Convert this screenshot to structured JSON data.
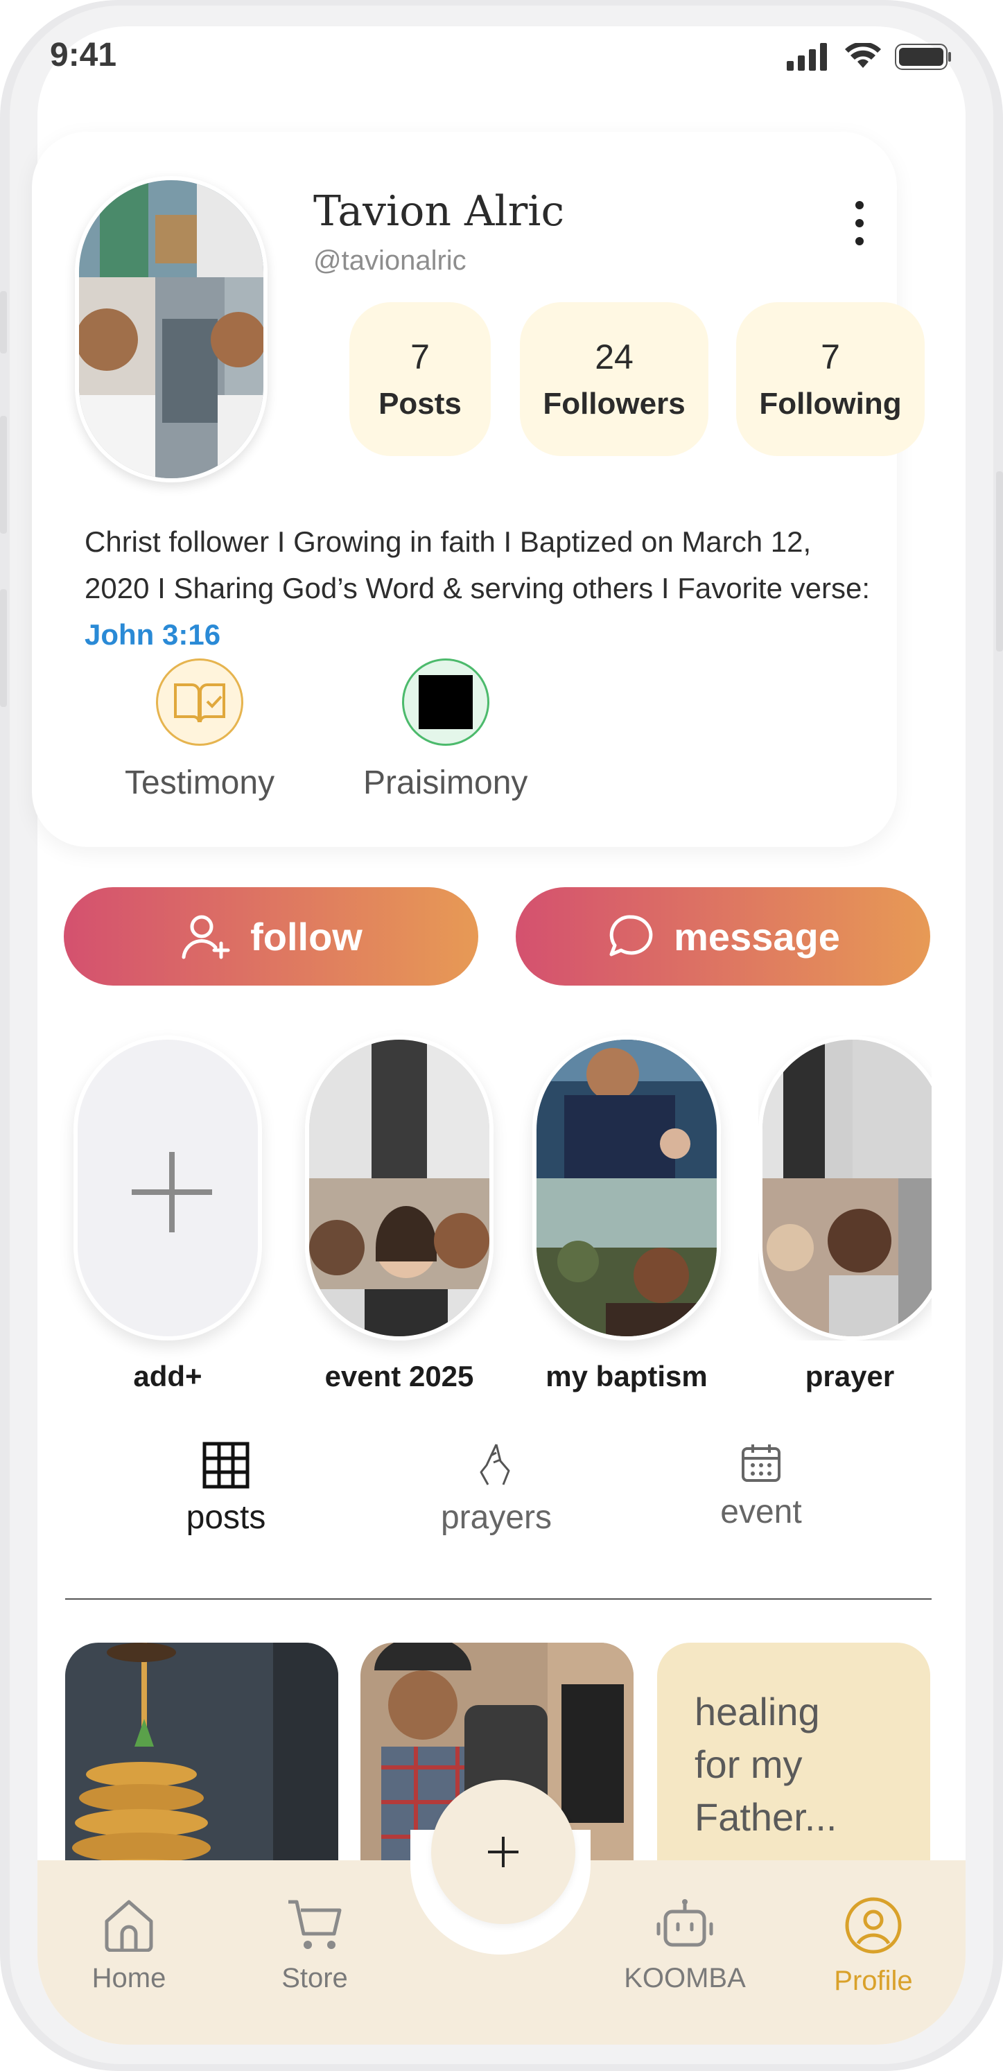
{
  "status_bar": {
    "time": "9:41"
  },
  "profile": {
    "name": "Tavion Alric",
    "handle": "@tavionalric",
    "stats": [
      {
        "value": "7",
        "label": "Posts"
      },
      {
        "value": "24",
        "label": "Followers"
      },
      {
        "value": "7",
        "label": "Following"
      }
    ],
    "bio_text": "Christ follower I Growing in faith I Baptized on March 12, 2020 I Sharing God’s Word & serving others I Favorite verse: ",
    "bio_verse": "John 3:16",
    "badges": [
      {
        "label": "Testimony",
        "icon": "book-check-icon"
      },
      {
        "label": "Praisimony",
        "icon": "black-square-icon"
      }
    ]
  },
  "actions": {
    "follow_label": "follow",
    "message_label": "message"
  },
  "stories": [
    {
      "label": "add+"
    },
    {
      "label": "event 2025"
    },
    {
      "label": "my baptism"
    },
    {
      "label": "prayer"
    }
  ],
  "tabs": [
    {
      "label": "posts",
      "icon": "grid-icon",
      "active": true
    },
    {
      "label": "prayers",
      "icon": "praying-hands-icon",
      "active": false
    },
    {
      "label": "event",
      "icon": "calendar-icon",
      "active": false
    }
  ],
  "posts": [
    {
      "type": "image",
      "subject": "pancakes"
    },
    {
      "type": "image",
      "subject": "hiker"
    },
    {
      "type": "text",
      "text": "healing for my Father..."
    }
  ],
  "nav": [
    {
      "label": "Home",
      "icon": "home-icon"
    },
    {
      "label": "Store",
      "icon": "cart-icon"
    },
    {
      "label": "KOOMBA",
      "icon": "robot-icon"
    },
    {
      "label": "Profile",
      "icon": "user-circle-icon",
      "active": true
    }
  ],
  "colors": {
    "accent_start": "#d4516f",
    "accent_end": "#e79a55",
    "stat_bg": "#fff8e3",
    "nav_bg": "#f5ecdc",
    "active_nav": "#d9a12a",
    "verse_link": "#2a8ad6"
  }
}
